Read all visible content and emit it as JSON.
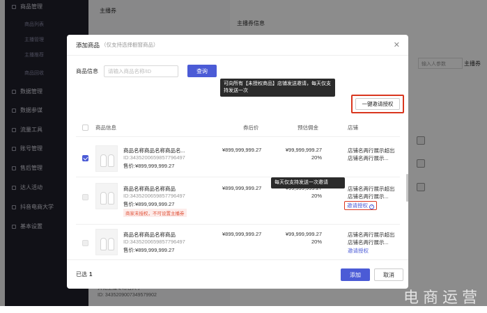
{
  "background": {
    "sidebar": [
      {
        "label": "商品管理",
        "sub": [
          "商品列表",
          "主播管理",
          "主播推荐",
          "商品回收"
        ]
      },
      {
        "label": "数据管理"
      },
      {
        "label": "数据参谋"
      },
      {
        "label": "流量工具"
      },
      {
        "label": "账号管理"
      },
      {
        "label": "售后管理"
      },
      {
        "label": "达人活动"
      },
      {
        "label": "抖音电商大学"
      },
      {
        "label": "基本设置"
      }
    ],
    "page_title": "主播券",
    "section_title": "主播券信息",
    "input_placeholder": "输入人参数",
    "label_right": "主播券",
    "bottom_lines": [
      "抖花主播专场名大学",
      "ID: 3435209007349579902"
    ]
  },
  "modal": {
    "title": "添加商品",
    "subtitle": "（仅支持选择橱窗商品）",
    "search": {
      "label": "商品信息",
      "placeholder": "请输入商品名称/ID",
      "query_label": "查询"
    },
    "invite_all_label": "一键邀请授权",
    "tooltip_all": "可向所有【未授权商品】店铺发送邀请，每天仅支持发送一次",
    "table": {
      "headers": {
        "info": "商品信息",
        "after_price": "券后价",
        "estimate": "预估佣金",
        "shop": "店铺"
      },
      "rows": [
        {
          "name": "商品名称商品名称商品名...",
          "id": "ID:3435200659857796497",
          "price": "售价:¥899,999,999.27",
          "after_price": "¥899,999,999.27",
          "commission": "¥99,999,999.27",
          "rate": "20%",
          "shop1": "店铺名两行展示超出",
          "shop2": "店铺名两行展示..."
        },
        {
          "name": "商品名称商品名称商品",
          "id": "ID:3435200659857796497",
          "price": "售价:¥899,999,999.27",
          "warn": "商家未授权，不可设置主播券",
          "after_price": "¥899,999,999.27",
          "commission": "¥99,999,999.27",
          "rate": "20%",
          "shop1": "店铺名两行展示超出",
          "shop2": "店铺名两行展示...",
          "invite": "邀请授权"
        },
        {
          "name": "商品名称商品名称商品",
          "id": "ID:3435200659857796497",
          "price": "售价:¥899,999,999.27",
          "after_price": "¥899,999,999.27",
          "commission": "¥99,999,999.27",
          "rate": "20%",
          "shop1": "店铺名两行展示超出",
          "shop2": "店铺名两行展示...",
          "invite": "邀请授权"
        }
      ]
    },
    "tooltip_single": "每天仅支持发送一次邀请",
    "footer": {
      "selected_label": "已选",
      "selected_count": "1",
      "add_label": "添加",
      "cancel_label": "取消"
    }
  },
  "watermark": "电商运营"
}
